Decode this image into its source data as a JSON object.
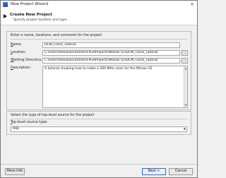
{
  "window": {
    "title": "New Project Wizard",
    "controls": {
      "close": "✕"
    }
  },
  "header": {
    "title": "Create New Project",
    "subtitle": "Specify project location and type."
  },
  "project_panel": {
    "label": "Enter a name, locations, and comment for the project",
    "name": {
      "label_underline": "N",
      "label_rest": "ame:",
      "value": "DCM_Clock_Tutorial"
    },
    "location": {
      "label_underline": "L",
      "label_rest": "ocation:",
      "value": "C:\\Users\\Alex\\Documents\\FPGAProjects\\Mimas V2\\DCM_Clock_Tutorial",
      "browse": "..."
    },
    "working_directory": {
      "label_underline": "W",
      "label_rest": "orking Directory:",
      "value": "C:\\Users\\Alex\\Documents\\FPGAProjects\\Mimas V2\\DCM_Clock_Tutorial",
      "browse": "..."
    },
    "description": {
      "label_underline": "D",
      "label_rest": "escription:",
      "value": "A tutorial showing how to make a 200 MHz clock for the Mimas V2"
    }
  },
  "source_panel": {
    "label": "Select the type of top-level source for the project",
    "field_label_underline": "T",
    "field_label_rest": "op-level source type:",
    "selected": "HDL"
  },
  "footer": {
    "more_info": "More Info",
    "next": "Next >",
    "cancel": "Cancel"
  }
}
